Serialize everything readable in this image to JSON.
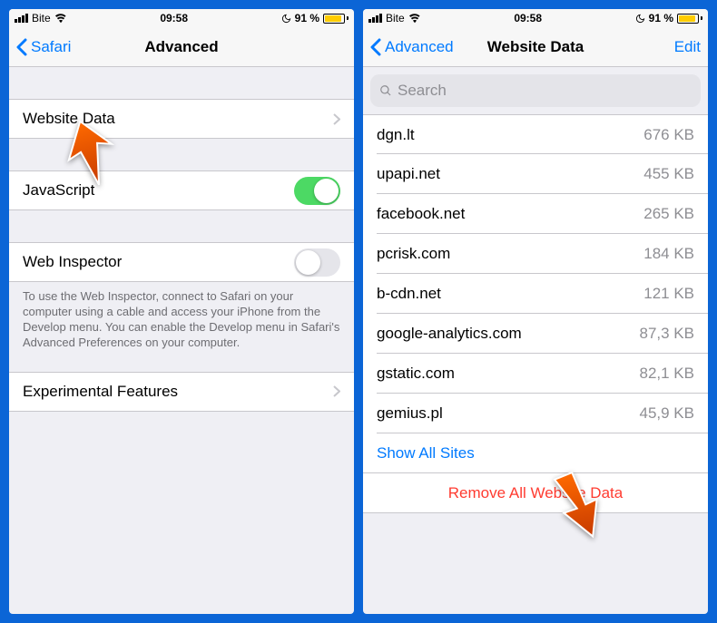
{
  "status": {
    "carrier": "Bite",
    "time": "09:58",
    "battery_pct": "91 %",
    "battery_fill_pct": 91
  },
  "left": {
    "back_label": "Safari",
    "title": "Advanced",
    "rows": {
      "website_data": "Website Data",
      "javascript": "JavaScript",
      "web_inspector": "Web Inspector",
      "experimental": "Experimental Features"
    },
    "inspector_footer": "To use the Web Inspector, connect to Safari on your computer using a cable and access your iPhone from the Develop menu. You can enable the Develop menu in Safari's Advanced Preferences on your computer."
  },
  "right": {
    "back_label": "Advanced",
    "title": "Website Data",
    "edit": "Edit",
    "search_placeholder": "Search",
    "sites": [
      {
        "domain": "dgn.lt",
        "size": "676 KB"
      },
      {
        "domain": "upapi.net",
        "size": "455 KB"
      },
      {
        "domain": "facebook.net",
        "size": "265 KB"
      },
      {
        "domain": "pcrisk.com",
        "size": "184 KB"
      },
      {
        "domain": "b-cdn.net",
        "size": "121 KB"
      },
      {
        "domain": "google-analytics.com",
        "size": "87,3 KB"
      },
      {
        "domain": "gstatic.com",
        "size": "82,1 KB"
      },
      {
        "domain": "gemius.pl",
        "size": "45,9 KB"
      }
    ],
    "show_all": "Show All Sites",
    "remove_all": "Remove All Website Data"
  }
}
